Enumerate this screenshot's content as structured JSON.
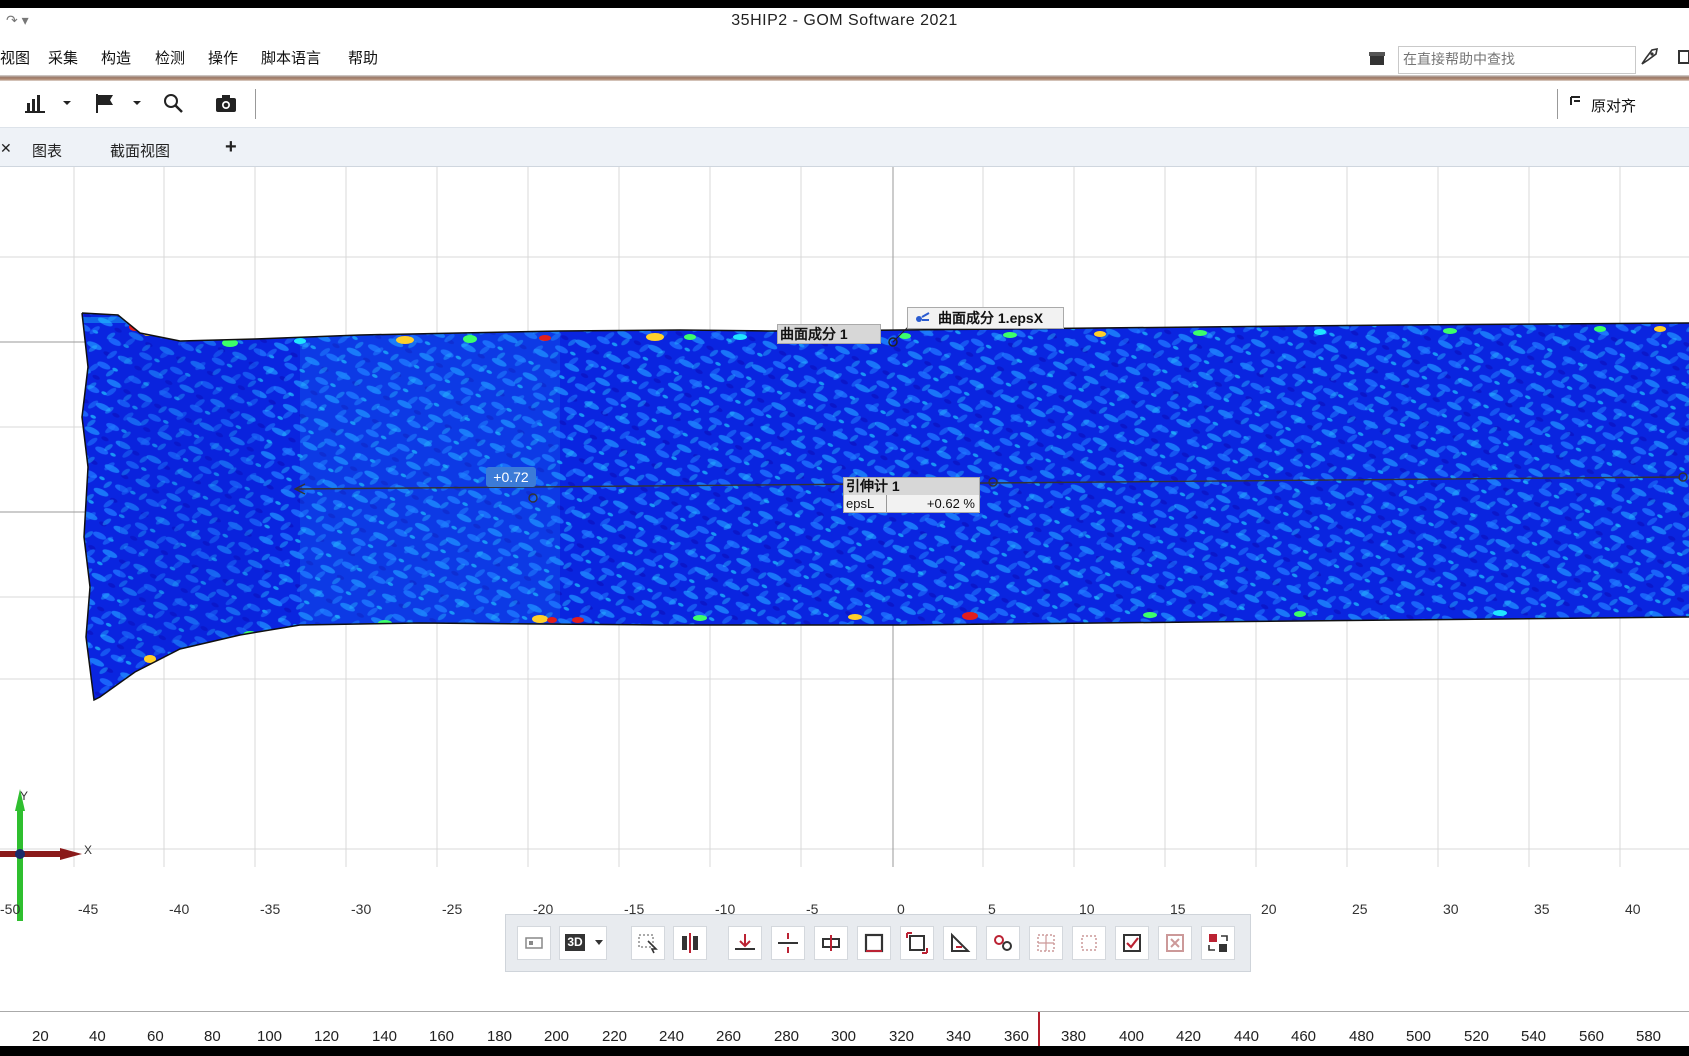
{
  "window": {
    "title": "35HIP2 - GOM Software 2021"
  },
  "menu": [
    "视图",
    "采集",
    "构造",
    "检测",
    "操作",
    "脚本语言",
    "帮助"
  ],
  "help_search": {
    "placeholder": "在直接帮助中查找"
  },
  "toolbar": {
    "align_label": "原对齐"
  },
  "tabs": {
    "close": "✕",
    "items": [
      "图表",
      "截面视图"
    ],
    "add": "+"
  },
  "viewport": {
    "grid_x_labels": [
      "-50",
      "-45",
      "-40",
      "-35",
      "-30",
      "-25",
      "-20",
      "-15",
      "-10",
      "-5",
      "0",
      "5",
      "10",
      "15",
      "20",
      "25",
      "30",
      "35",
      "40"
    ],
    "axis": {
      "y": "Y",
      "x": "X"
    },
    "labels": {
      "surface_component": "曲面成分 1",
      "surface_epsx": "曲面成分 1.epsX",
      "extensometer": "引伸计 1",
      "extensometer_key": "epsL",
      "extensometer_value": "+0.62 %",
      "point_value": "+0.72"
    },
    "colors": {
      "deep_blue": "#0a25e0",
      "light_blue": "#1d8bff",
      "cyan": "#20e6ff",
      "green": "#3cff6a",
      "yellow": "#ffd02a",
      "red": "#e21e1e",
      "selected_bg": "#3b7bd8"
    }
  },
  "view_toolbar": {
    "mode_label": "3D",
    "button_icons": [
      "view-layout-icon",
      "3d-view-icon",
      "select-icon",
      "split-icon",
      "align-bottom-icon",
      "align-middle-icon",
      "distribute-icon",
      "frame-icon",
      "fit-icon",
      "angle-icon",
      "link-icon",
      "grid-select-icon",
      "deselect-icon",
      "check-icon",
      "close-box-icon",
      "swap-icon"
    ]
  },
  "stage_ruler": {
    "ticks": [
      "20",
      "40",
      "60",
      "80",
      "100",
      "120",
      "140",
      "160",
      "180",
      "200",
      "220",
      "240",
      "260",
      "280",
      "300",
      "320",
      "340",
      "360",
      "380",
      "400",
      "420",
      "440",
      "460",
      "480",
      "500",
      "520",
      "540",
      "560",
      "580"
    ],
    "current_stage": 364
  }
}
